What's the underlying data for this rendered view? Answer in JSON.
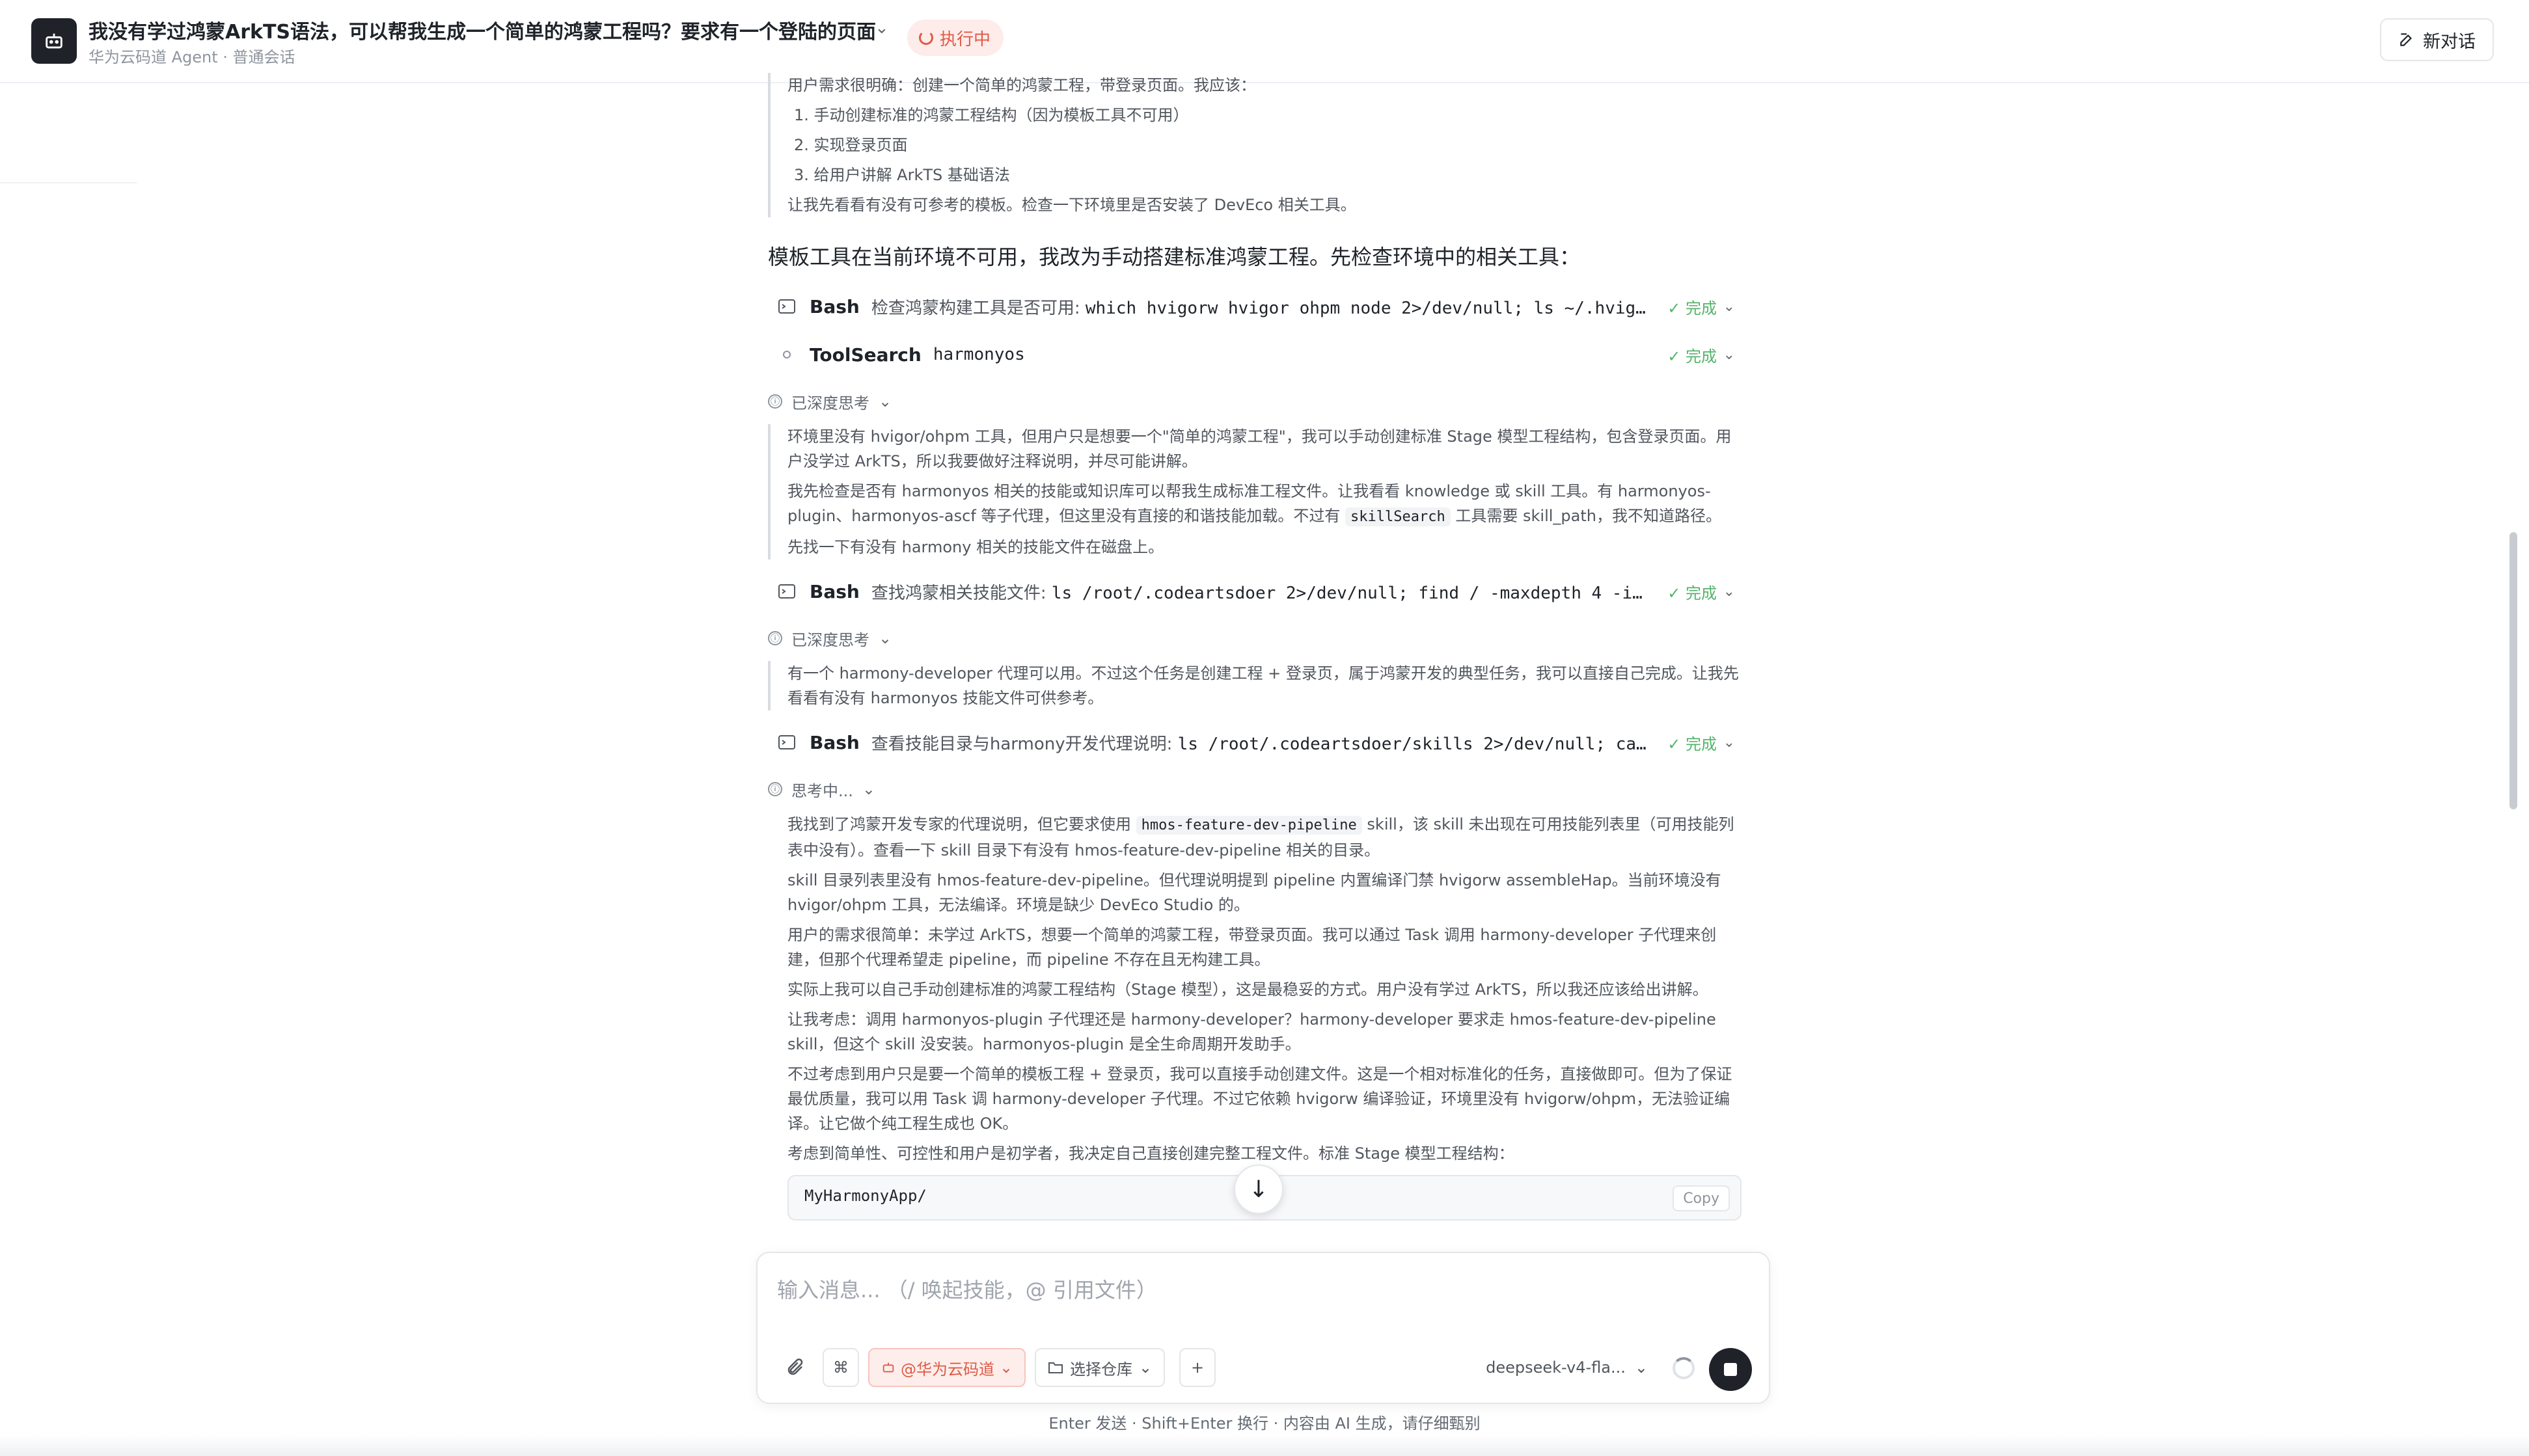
{
  "header": {
    "title": "我没有学过鸿蒙ArkTS语法，可以帮我生成一个简单的鸿蒙工程吗？要求有一个登陆的页面",
    "subtitle": "华为云码道 Agent · 普通会话",
    "status": "执行中",
    "new_chat": "新对话"
  },
  "content": {
    "intro_quote": {
      "line0": "用户需求很明确：创建一个简单的鸿蒙工程，带登录页面。我应该：",
      "items": [
        "1. 手动创建标准的鸿蒙工程结构（因为模板工具不可用）",
        "2. 实现登录页面",
        "3. 给用户讲解 ArkTS 基础语法"
      ],
      "tail": "让我先看看有没有可参考的模板。检查一下环境里是否安装了 DevEco 相关工具。"
    },
    "heading": "模板工具在当前环境不可用，我改为手动搭建标准鸿蒙工程。先检查环境中的相关工具：",
    "tool1": {
      "name": "Bash",
      "desc": "检查鸿蒙构建工具是否可用:",
      "cmd": "which hvigorw hvigor ohpm node 2>/dev/null; ls ~/.hvig…",
      "status": "✓ 完成"
    },
    "tool2": {
      "name": "ToolSearch",
      "cmd": "harmonyos",
      "status": "✓ 完成"
    },
    "think1": {
      "label": "已深度思考",
      "p1": "环境里没有 hvigor/ohpm 工具，但用户只是想要一个\"简单的鸿蒙工程\"，我可以手动创建标准 Stage 模型工程结构，包含登录页面。用户没学过 ArkTS，所以我要做好注释说明，并尽可能讲解。",
      "p2a": "我先检查是否有 harmonyos 相关的技能或知识库可以帮我生成标准工程文件。让我看看 knowledge 或 skill 工具。有 harmonyos-plugin、harmonyos-ascf 等子代理，但这里没有直接的和谐技能加载。不过有",
      "p2code": "skillSearch",
      "p2b": "工具需要 skill_path，我不知道路径。",
      "p3": "先找一下有没有 harmony 相关的技能文件在磁盘上。"
    },
    "tool3": {
      "name": "Bash",
      "desc": "查找鸿蒙相关技能文件:",
      "cmd": "ls /root/.codeartsdoer 2>/dev/null; find / -maxdepth 4 -i…",
      "status": "✓ 完成"
    },
    "think2": {
      "label": "已深度思考",
      "p1": "有一个 harmony-developer 代理可以用。不过这个任务是创建工程 + 登录页，属于鸿蒙开发的典型任务，我可以直接自己完成。让我先看看有没有 harmonyos 技能文件可供参考。"
    },
    "tool4": {
      "name": "Bash",
      "desc": "查看技能目录与harmony开发代理说明:",
      "cmd": "ls /root/.codeartsdoer/skills 2>/dev/null; ca…",
      "status": "✓ 完成"
    },
    "think3": {
      "label": "思考中...",
      "p1a": "我找到了鸿蒙开发专家的代理说明，但它要求使用",
      "p1code": "hmos-feature-dev-pipeline",
      "p1b": "skill，该 skill 未出现在可用技能列表里（可用技能列表中没有）。查看一下 skill 目录下有没有 hmos-feature-dev-pipeline 相关的目录。",
      "p2": "skill 目录列表里没有 hmos-feature-dev-pipeline。但代理说明提到 pipeline 内置编译门禁 hvigorw assembleHap。当前环境没有 hvigor/ohpm 工具，无法编译。环境是缺少 DevEco Studio 的。",
      "p3": "用户的需求很简单：未学过 ArkTS，想要一个简单的鸿蒙工程，带登录页面。我可以通过 Task 调用 harmony-developer 子代理来创建，但那个代理希望走 pipeline，而 pipeline 不存在且无构建工具。",
      "p4": "实际上我可以自己手动创建标准的鸿蒙工程结构（Stage 模型），这是最稳妥的方式。用户没有学过 ArkTS，所以我还应该给出讲解。",
      "p5": "让我考虑：调用 harmonyos-plugin 子代理还是 harmony-developer？harmony-developer 要求走 hmos-feature-dev-pipeline skill，但这个 skill 没安装。harmonyos-plugin 是全生命周期开发助手。",
      "p6": "不过考虑到用户只是要一个简单的模板工程 + 登录页，我可以直接手动创建文件。这是一个相对标准化的任务，直接做即可。但为了保证最优质量，我可以用 Task 调 harmony-developer 子代理。不过它依赖 hvigorw 编译验证，环境里没有 hvigorw/ohpm，无法验证编译。让它做个纯工程生成也 OK。",
      "p7": "考虑到简单性、可控性和用户是初学者，我决定自己直接创建完整工程文件。标准 Stage 模型工程结构："
    },
    "code": {
      "text": "MyHarmonyApp/",
      "copy": "Copy"
    }
  },
  "composer": {
    "placeholder": "输入消息...  （/ 唤起技能，@ 引用文件）",
    "org_chip": "@华为云码道",
    "repo_chip": "选择仓库",
    "model": "deepseek-v4-fla..."
  },
  "footer": "Enter 发送 · Shift+Enter 换行 · 内容由 AI 生成，请仔细甄别",
  "colors": {
    "accent": "#e05a47",
    "success": "#54b46a",
    "dark": "#1f2329"
  }
}
